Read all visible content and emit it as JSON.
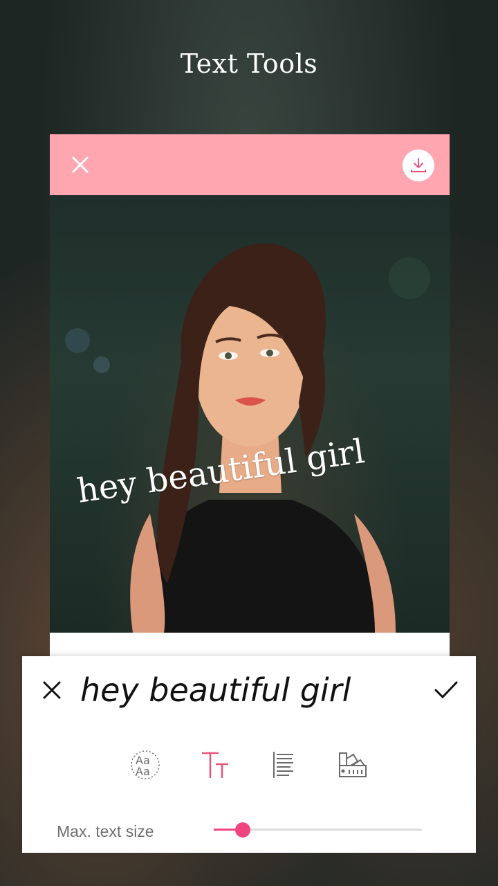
{
  "page": {
    "title": "Text Tools"
  },
  "editor": {
    "overlay_text": "hey beautiful girl"
  },
  "text_panel": {
    "input_value": "hey beautiful girl",
    "tools": [
      {
        "name": "font-style-icon",
        "active": false
      },
      {
        "name": "text-size-icon",
        "active": true
      },
      {
        "name": "text-align-icon",
        "active": false
      },
      {
        "name": "color-palette-icon",
        "active": false
      }
    ],
    "slider": {
      "label": "Max. text size",
      "value": 0.14
    }
  },
  "colors": {
    "header_pink": "#ffa6b0",
    "accent_pink": "#f0457f",
    "active_icon": "#e8557a",
    "icon_gray": "#6a6a6a"
  }
}
